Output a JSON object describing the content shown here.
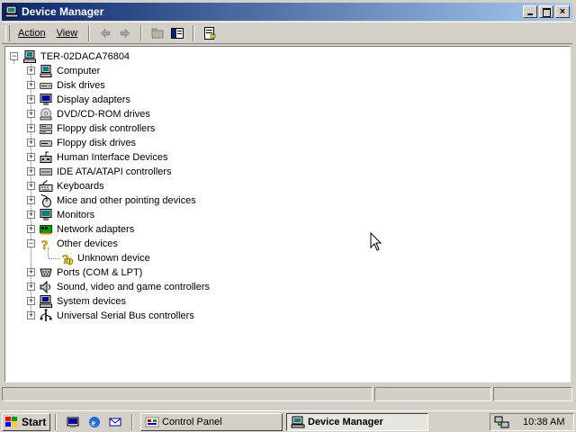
{
  "window": {
    "title": "Device Manager",
    "buttons": {
      "minimize": "minimize",
      "maximize": "maximize",
      "close": "×"
    }
  },
  "toolbar": {
    "action_label": "Action",
    "view_label": "View",
    "icons": [
      "back-arrow-icon",
      "forward-arrow-icon",
      "up-folder-icon",
      "show-hide-tree-icon",
      "properties-icon"
    ]
  },
  "tree": {
    "root": "TER-02DACA76804",
    "items": [
      {
        "label": "Computer",
        "icon": "computer-icon"
      },
      {
        "label": "Disk drives",
        "icon": "disk-drive-icon"
      },
      {
        "label": "Display adapters",
        "icon": "display-adapter-icon"
      },
      {
        "label": "DVD/CD-ROM drives",
        "icon": "cd-drive-icon"
      },
      {
        "label": "Floppy disk controllers",
        "icon": "floppy-controller-icon"
      },
      {
        "label": "Floppy disk drives",
        "icon": "floppy-drive-icon"
      },
      {
        "label": "Human Interface Devices",
        "icon": "hid-icon"
      },
      {
        "label": "IDE ATA/ATAPI controllers",
        "icon": "ide-controller-icon"
      },
      {
        "label": "Keyboards",
        "icon": "keyboard-icon"
      },
      {
        "label": "Mice and other pointing devices",
        "icon": "mouse-icon"
      },
      {
        "label": "Monitors",
        "icon": "monitor-icon"
      },
      {
        "label": "Network adapters",
        "icon": "network-adapter-icon"
      },
      {
        "label": "Other devices",
        "icon": "question-mark-icon",
        "expanded": true,
        "children": [
          {
            "label": "Unknown device",
            "icon": "unknown-device-warning-icon"
          }
        ]
      },
      {
        "label": "Ports (COM & LPT)",
        "icon": "port-icon"
      },
      {
        "label": "Sound, video and game controllers",
        "icon": "speaker-icon"
      },
      {
        "label": "System devices",
        "icon": "system-device-icon"
      },
      {
        "label": "Universal Serial Bus controllers",
        "icon": "usb-icon"
      }
    ]
  },
  "taskbar": {
    "start_label": "Start",
    "tasks": [
      {
        "label": "Control Panel",
        "active": false
      },
      {
        "label": "Device Manager",
        "active": true
      }
    ],
    "clock": "10:38 AM"
  },
  "colors": {
    "title_gradient_start": "#0a246a",
    "title_gradient_end": "#a6caf0",
    "face": "#d4d0c8"
  }
}
